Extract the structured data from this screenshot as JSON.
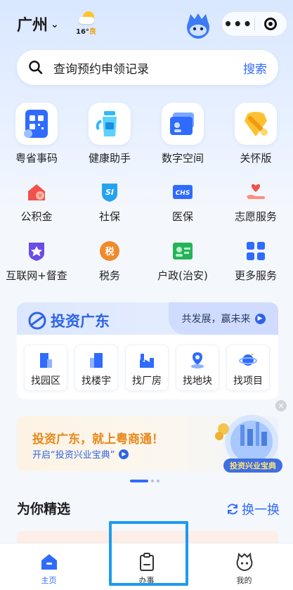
{
  "header": {
    "city": "广州",
    "weather_temp": "16°",
    "weather_quality": "良",
    "colors": {
      "accent": "#2f6bff"
    }
  },
  "search": {
    "placeholder": "查询预约申领记录",
    "button": "搜索"
  },
  "featured_services": [
    {
      "label": "粤省事码",
      "icon": "qr-code-icon"
    },
    {
      "label": "健康助手",
      "icon": "health-bottle-icon"
    },
    {
      "label": "数字空间",
      "icon": "digital-space-icon"
    },
    {
      "label": "关怀版",
      "icon": "care-ribbon-icon"
    }
  ],
  "services_row1": [
    {
      "label": "公积金",
      "icon": "housing-fund-icon"
    },
    {
      "label": "社保",
      "icon": "social-security-icon"
    },
    {
      "label": "医保",
      "icon": "medical-insurance-icon"
    },
    {
      "label": "志愿服务",
      "icon": "volunteer-hand-icon"
    }
  ],
  "services_row2": [
    {
      "label": "互联网+督查",
      "icon": "supervision-star-icon"
    },
    {
      "label": "税务",
      "icon": "tax-icon"
    },
    {
      "label": "户政(治安)",
      "icon": "household-card-icon"
    },
    {
      "label": "更多服务",
      "icon": "more-grid-icon"
    }
  ],
  "invest": {
    "title": "投资广东",
    "slogan": "共发展，赢未来",
    "items": [
      {
        "label": "找园区",
        "icon": "park-building-icon"
      },
      {
        "label": "找楼宇",
        "icon": "tower-building-icon"
      },
      {
        "label": "找厂房",
        "icon": "factory-icon"
      },
      {
        "label": "找地块",
        "icon": "land-pin-icon"
      },
      {
        "label": "找项目",
        "icon": "project-planet-icon"
      }
    ]
  },
  "banner": {
    "headline": "投资广东，就上粤商通！",
    "subline": "开启“投资兴业宝典”",
    "badge_text": "投资兴业宝典"
  },
  "section": {
    "title": "为你精选",
    "refresh": "换一换"
  },
  "tabbar": [
    {
      "label": "主页",
      "icon": "home-icon",
      "active": true
    },
    {
      "label": "办事",
      "icon": "clipboard-icon",
      "active": false
    },
    {
      "label": "我的",
      "icon": "profile-mascot-icon",
      "active": false
    }
  ]
}
